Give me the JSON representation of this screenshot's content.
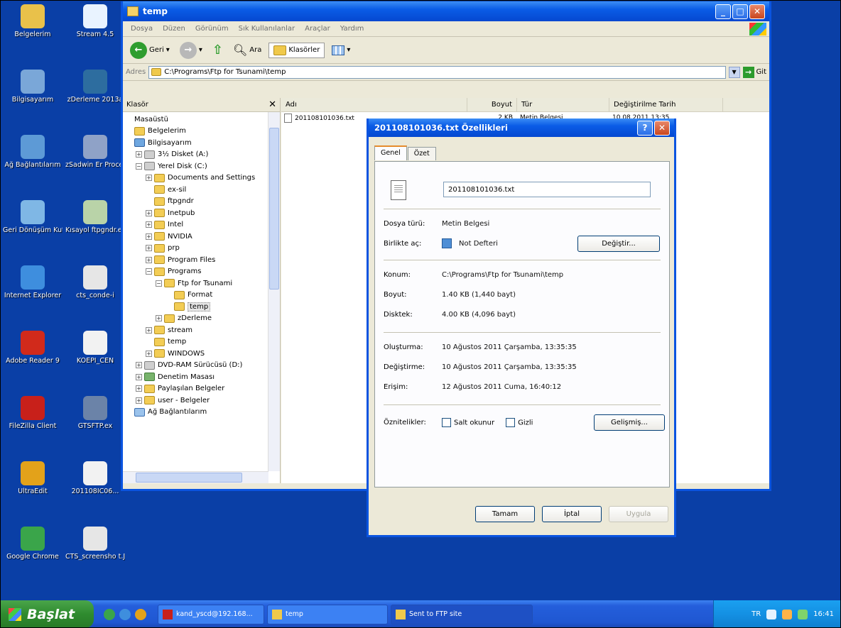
{
  "desktop_icons": [
    {
      "label": "Belgelerim",
      "color": "#e9c14a"
    },
    {
      "label": "Stream 4.5",
      "color": "#e9f3ff"
    },
    {
      "label": "Bilgisayarım",
      "color": "#7aa7d8"
    },
    {
      "label": "zDerleme 2013a",
      "color": "#2d6d9f"
    },
    {
      "label": "Ağ Bağlantılarım",
      "color": "#5d9ad6"
    },
    {
      "label": "zSadwin Er Processing",
      "color": "#8fa2c7"
    },
    {
      "label": "Geri Dönüşüm Kutusu",
      "color": "#7fb7e5"
    },
    {
      "label": "Kısayol ftpgndr.ex",
      "color": "#b9d3a8"
    },
    {
      "label": "Internet Explorer",
      "color": "#3e8ede"
    },
    {
      "label": "cts_conde-i",
      "color": "#e6e6e6"
    },
    {
      "label": "Adobe Reader 9",
      "color": "#d12a1b"
    },
    {
      "label": "KOEPI_CEN",
      "color": "#f2f2f2"
    },
    {
      "label": "FileZilla Client",
      "color": "#c8201a"
    },
    {
      "label": "GTSFTP.ex",
      "color": "#6b83a8"
    },
    {
      "label": "UltraEdit",
      "color": "#e3a21a"
    },
    {
      "label": "201108IC06...",
      "color": "#f2f2f2"
    },
    {
      "label": "Google Chrome",
      "color": "#3aa54a"
    },
    {
      "label": "CTS_screensho t.JPG",
      "color": "#e6e6e6"
    }
  ],
  "explorer": {
    "title": "temp",
    "menu": [
      "Dosya",
      "Düzen",
      "Görünüm",
      "Sık Kullanılanlar",
      "Araçlar",
      "Yardım"
    ],
    "back_label": "Geri",
    "search_label": "Ara",
    "folders_label": "Klasörler",
    "address_label": "Adres",
    "address_value": "C:\\Programs\\Ftp for Tsunami\\temp",
    "go_label": "Git",
    "pane_title": "Klasör",
    "tree": [
      {
        "label": "Masaüstü",
        "indent": 0,
        "icon": "none",
        "pm": ""
      },
      {
        "label": "Belgelerim",
        "indent": 0,
        "icon": "folder",
        "pm": ""
      },
      {
        "label": "Bilgisayarım",
        "indent": 0,
        "icon": "pc",
        "pm": ""
      },
      {
        "label": "3½ Disket (A:)",
        "indent": 1,
        "icon": "drive",
        "pm": "+"
      },
      {
        "label": "Yerel Disk (C:)",
        "indent": 1,
        "icon": "drive",
        "pm": "−"
      },
      {
        "label": "Documents and Settings",
        "indent": 2,
        "icon": "folder",
        "pm": "+"
      },
      {
        "label": "ex-sil",
        "indent": 2,
        "icon": "folder",
        "pm": ""
      },
      {
        "label": "ftpgndr",
        "indent": 2,
        "icon": "folder",
        "pm": ""
      },
      {
        "label": "Inetpub",
        "indent": 2,
        "icon": "folder",
        "pm": "+"
      },
      {
        "label": "Intel",
        "indent": 2,
        "icon": "folder",
        "pm": "+"
      },
      {
        "label": "NVIDIA",
        "indent": 2,
        "icon": "folder",
        "pm": "+"
      },
      {
        "label": "prp",
        "indent": 2,
        "icon": "folder",
        "pm": "+"
      },
      {
        "label": "Program Files",
        "indent": 2,
        "icon": "folder",
        "pm": "+"
      },
      {
        "label": "Programs",
        "indent": 2,
        "icon": "folder",
        "pm": "−"
      },
      {
        "label": "Ftp for Tsunami",
        "indent": 3,
        "icon": "folder",
        "pm": "−"
      },
      {
        "label": "Format",
        "indent": 4,
        "icon": "folder",
        "pm": ""
      },
      {
        "label": "temp",
        "indent": 4,
        "icon": "folder",
        "pm": "",
        "selected": true
      },
      {
        "label": "zDerleme",
        "indent": 3,
        "icon": "folder",
        "pm": "+"
      },
      {
        "label": "stream",
        "indent": 2,
        "icon": "folder",
        "pm": "+"
      },
      {
        "label": "temp",
        "indent": 2,
        "icon": "folder",
        "pm": ""
      },
      {
        "label": "WINDOWS",
        "indent": 2,
        "icon": "folder",
        "pm": "+"
      },
      {
        "label": "DVD-RAM Sürücüsü (D:)",
        "indent": 1,
        "icon": "drive",
        "pm": "+"
      },
      {
        "label": "Denetim Masası",
        "indent": 1,
        "icon": "panel",
        "pm": "+"
      },
      {
        "label": "Paylaşılan Belgeler",
        "indent": 1,
        "icon": "folder",
        "pm": "+"
      },
      {
        "label": "user - Belgeler",
        "indent": 1,
        "icon": "folder",
        "pm": "+"
      },
      {
        "label": "Ağ Bağlantılarım",
        "indent": 0,
        "icon": "net",
        "pm": ""
      }
    ],
    "columns": [
      "Adı",
      "Boyut",
      "Tür",
      "Değiştirilme Tarih"
    ],
    "files": [
      {
        "name": "201108101036.txt",
        "size": "2 KB",
        "type": "Metin Belgesi",
        "date": "10.08.2011 13:35"
      }
    ]
  },
  "dialog": {
    "title": "201108101036.txt Özellikleri",
    "tabs": [
      "Genel",
      "Özet"
    ],
    "filename": "201108101036.txt",
    "rows": {
      "type_k": "Dosya türü:",
      "type_v": "Metin Belgesi",
      "opens_k": "Birlikte aç:",
      "opens_v": "Not Defteri",
      "change_label": "Değiştir...",
      "loc_k": "Konum:",
      "loc_v": "C:\\Programs\\Ftp for Tsunami\\temp",
      "size_k": "Boyut:",
      "size_v": "1.40 KB (1,440 bayt)",
      "disk_k": "Disktek:",
      "disk_v": "4.00 KB (4,096 bayt)",
      "created_k": "Oluşturma:",
      "created_v": "10 Ağustos 2011 Çarşamba, 13:35:35",
      "modified_k": "Değiştirme:",
      "modified_v": "10 Ağustos 2011 Çarşamba, 13:35:35",
      "access_k": "Erişim:",
      "access_v": "12 Ağustos 2011 Cuma, 16:40:12",
      "attr_k": "Öznitelikler:",
      "readonly_label": "Salt okunur",
      "hidden_label": "Gizli",
      "advanced_label": "Gelişmiş..."
    },
    "ok_label": "Tamam",
    "cancel_label": "İptal",
    "apply_label": "Uygula"
  },
  "taskbar": {
    "start_label": "Başlat",
    "tasks": [
      {
        "label": "kand_yscd@192.168...",
        "width": 150,
        "active": false
      },
      {
        "label": "temp",
        "width": 170,
        "active": false
      },
      {
        "label": "Sent to FTP site",
        "width": 200,
        "active": true
      }
    ],
    "lang": "TR",
    "clock": "16:41"
  }
}
